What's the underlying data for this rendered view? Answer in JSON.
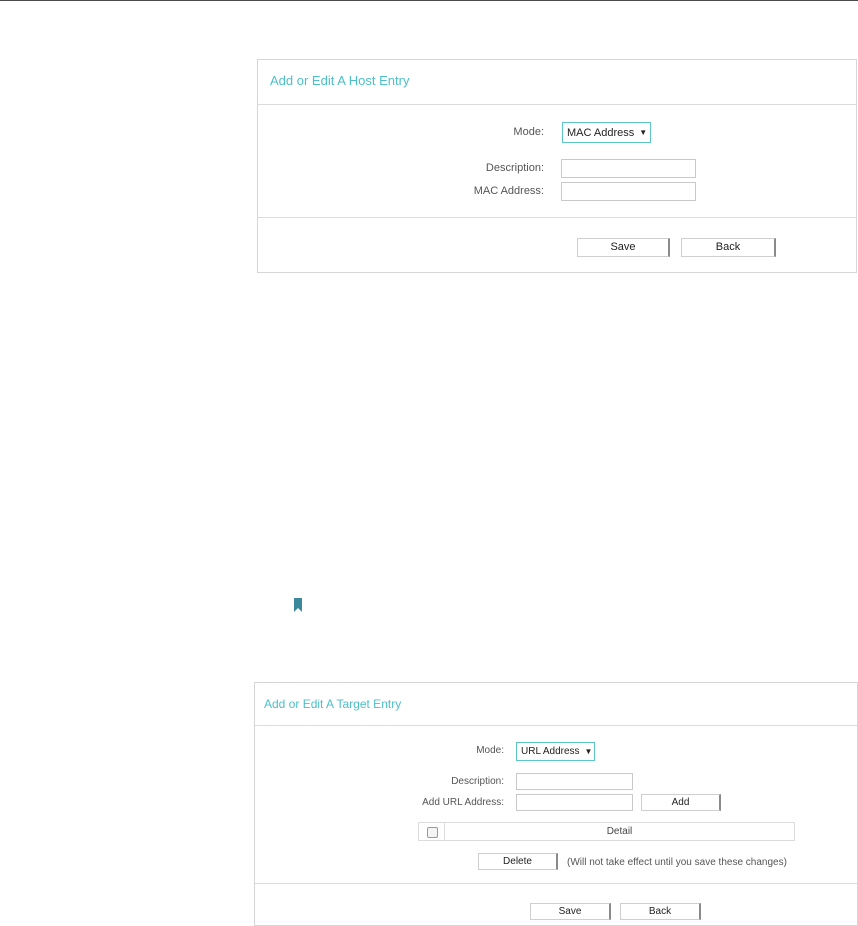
{
  "host_entry": {
    "title": "Add or Edit A Host Entry",
    "mode_label": "Mode:",
    "mode_value": "MAC Address",
    "description_label": "Description:",
    "description_value": "",
    "mac_label": "MAC Address:",
    "mac_value": "",
    "save_label": "Save",
    "back_label": "Back"
  },
  "target_entry": {
    "title": "Add or Edit A Target Entry",
    "mode_label": "Mode:",
    "mode_value": "URL Address",
    "description_label": "Description:",
    "description_value": "",
    "url_label": "Add URL Address:",
    "url_value": "",
    "add_label": "Add",
    "table_header_detail": "Detail",
    "delete_label": "Delete",
    "delete_note": "(Will not take effect until you save these changes)",
    "save_label": "Save",
    "back_label": "Back"
  },
  "colors": {
    "accent": "#4bc0c8",
    "bookmark": "#3a8a9c"
  },
  "icons": {
    "bookmark": "bookmark-icon",
    "dropdown_arrow": "caret-down-icon"
  }
}
